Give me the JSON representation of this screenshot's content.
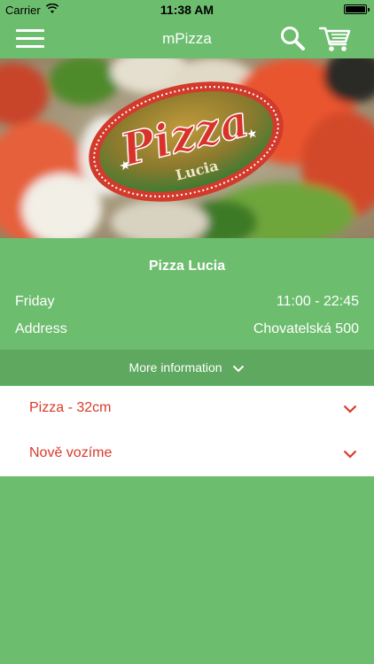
{
  "status_bar": {
    "carrier": "Carrier",
    "time": "11:38 AM",
    "wifi_icon": "wifi-icon",
    "battery_icon": "battery-icon"
  },
  "nav": {
    "title": "mPizza",
    "menu_icon": "hamburger-menu-icon",
    "search_icon": "search-icon",
    "cart_icon": "shopping-cart-icon"
  },
  "hero": {
    "logo_text_main": "Pizza",
    "logo_text_sub": "Lucia"
  },
  "restaurant": {
    "name": "Pizza Lucia",
    "hours_label": "Friday",
    "hours_value": "11:00 - 22:45",
    "address_label": "Address",
    "address_value": "Chovatelská 500"
  },
  "more_information": {
    "label": "More information",
    "icon": "chevron-down-icon"
  },
  "categories": [
    {
      "label": "Pizza - 32cm"
    },
    {
      "label": "Nově vozíme"
    }
  ],
  "colors": {
    "primary_green": "#6dbd6f",
    "dark_green": "#5ea860",
    "accent_red": "#d93a2b",
    "white": "#ffffff"
  }
}
